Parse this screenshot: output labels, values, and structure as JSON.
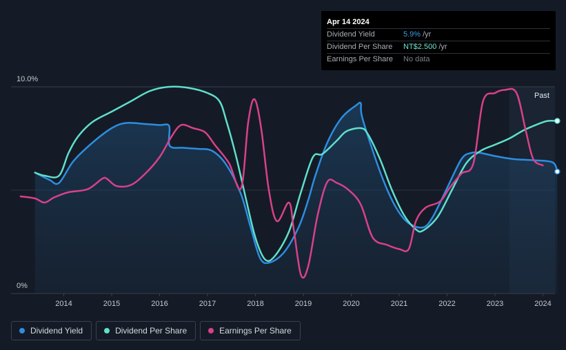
{
  "tooltip": {
    "date": "Apr 14 2024",
    "rows": [
      {
        "label": "Dividend Yield",
        "value": "5.9%",
        "unit": "/yr",
        "color": "#3a9de8"
      },
      {
        "label": "Dividend Per Share",
        "value": "NT$2.500",
        "unit": "/yr",
        "color": "#6ee6d2"
      },
      {
        "label": "Earnings Per Share",
        "value": "No data",
        "unit": "",
        "color": "#7d828c"
      }
    ]
  },
  "past_label": "Past",
  "legend": [
    {
      "label": "Dividend Yield",
      "color": "#2c8ee2"
    },
    {
      "label": "Dividend Per Share",
      "color": "#5fe0cc"
    },
    {
      "label": "Earnings Per Share",
      "color": "#d9418a"
    }
  ],
  "chart_data": {
    "type": "line",
    "x_ticks": [
      "2014",
      "2015",
      "2016",
      "2017",
      "2018",
      "2019",
      "2020",
      "2021",
      "2022",
      "2023",
      "2024"
    ],
    "y_ticks": [
      "0%",
      "10.0%"
    ],
    "y_range": [
      0,
      10
    ],
    "x_range": [
      2013.0,
      2024.3
    ],
    "grid": "horizontal",
    "forecast_shading_from": 2023.3,
    "series": [
      {
        "name": "Dividend Yield",
        "color": "#2c8ee2",
        "unit": "%",
        "points": [
          [
            2013.4,
            5.85
          ],
          [
            2013.7,
            5.5
          ],
          [
            2013.9,
            5.35
          ],
          [
            2014.2,
            6.4
          ],
          [
            2014.6,
            7.3
          ],
          [
            2015.0,
            8.0
          ],
          [
            2015.3,
            8.25
          ],
          [
            2015.7,
            8.2
          ],
          [
            2016.0,
            8.15
          ],
          [
            2016.2,
            8.1
          ],
          [
            2016.21,
            7.15
          ],
          [
            2016.5,
            7.05
          ],
          [
            2016.8,
            7.0
          ],
          [
            2017.1,
            6.9
          ],
          [
            2017.4,
            6.2
          ],
          [
            2017.7,
            4.8
          ],
          [
            2017.9,
            3.2
          ],
          [
            2018.1,
            1.7
          ],
          [
            2018.3,
            1.5
          ],
          [
            2018.6,
            2.0
          ],
          [
            2018.9,
            3.2
          ],
          [
            2019.1,
            4.5
          ],
          [
            2019.25,
            5.7
          ],
          [
            2019.5,
            7.3
          ],
          [
            2019.8,
            8.5
          ],
          [
            2020.1,
            9.1
          ],
          [
            2020.2,
            9.2
          ],
          [
            2020.22,
            8.6
          ],
          [
            2020.45,
            6.9
          ],
          [
            2020.7,
            5.3
          ],
          [
            2020.95,
            4.1
          ],
          [
            2021.2,
            3.4
          ],
          [
            2021.5,
            3.2
          ],
          [
            2021.7,
            3.7
          ],
          [
            2022.0,
            5.1
          ],
          [
            2022.3,
            6.5
          ],
          [
            2022.5,
            6.8
          ],
          [
            2022.7,
            6.8
          ],
          [
            2023.0,
            6.65
          ],
          [
            2023.4,
            6.5
          ],
          [
            2023.8,
            6.45
          ],
          [
            2024.2,
            6.35
          ],
          [
            2024.3,
            5.9
          ]
        ]
      },
      {
        "name": "Dividend Per Share",
        "color": "#5fe0cc",
        "unit": "NT$",
        "points": [
          [
            2013.4,
            5.85
          ],
          [
            2013.6,
            5.7
          ],
          [
            2013.9,
            5.7
          ],
          [
            2014.1,
            6.8
          ],
          [
            2014.3,
            7.6
          ],
          [
            2014.6,
            8.3
          ],
          [
            2015.0,
            8.8
          ],
          [
            2015.4,
            9.3
          ],
          [
            2015.8,
            9.8
          ],
          [
            2016.2,
            10.0
          ],
          [
            2016.6,
            9.95
          ],
          [
            2017.0,
            9.7
          ],
          [
            2017.25,
            9.3
          ],
          [
            2017.4,
            8.3
          ],
          [
            2017.6,
            6.6
          ],
          [
            2017.8,
            4.6
          ],
          [
            2018.0,
            2.7
          ],
          [
            2018.2,
            1.65
          ],
          [
            2018.4,
            1.8
          ],
          [
            2018.7,
            3.0
          ],
          [
            2018.95,
            4.9
          ],
          [
            2019.2,
            6.6
          ],
          [
            2019.4,
            6.75
          ],
          [
            2019.7,
            7.4
          ],
          [
            2019.9,
            7.85
          ],
          [
            2020.2,
            8.0
          ],
          [
            2020.35,
            7.7
          ],
          [
            2020.6,
            6.5
          ],
          [
            2020.85,
            5.0
          ],
          [
            2021.1,
            3.8
          ],
          [
            2021.35,
            3.1
          ],
          [
            2021.5,
            3.05
          ],
          [
            2021.8,
            3.7
          ],
          [
            2022.1,
            5.0
          ],
          [
            2022.4,
            6.3
          ],
          [
            2022.7,
            6.9
          ],
          [
            2023.0,
            7.2
          ],
          [
            2023.3,
            7.5
          ],
          [
            2023.6,
            7.9
          ],
          [
            2023.9,
            8.2
          ],
          [
            2024.1,
            8.35
          ],
          [
            2024.3,
            8.35
          ]
        ]
      },
      {
        "name": "Earnings Per Share",
        "color": "#d9418a",
        "unit": "NT$",
        "points": [
          [
            2013.1,
            4.7
          ],
          [
            2013.4,
            4.6
          ],
          [
            2013.6,
            4.4
          ],
          [
            2013.8,
            4.65
          ],
          [
            2014.1,
            4.9
          ],
          [
            2014.5,
            5.05
          ],
          [
            2014.8,
            5.55
          ],
          [
            2014.9,
            5.55
          ],
          [
            2015.1,
            5.2
          ],
          [
            2015.4,
            5.25
          ],
          [
            2015.7,
            5.8
          ],
          [
            2016.0,
            6.6
          ],
          [
            2016.25,
            7.6
          ],
          [
            2016.45,
            8.15
          ],
          [
            2016.7,
            8.0
          ],
          [
            2016.95,
            7.8
          ],
          [
            2017.15,
            7.2
          ],
          [
            2017.45,
            6.3
          ],
          [
            2017.7,
            5.1
          ],
          [
            2017.85,
            8.3
          ],
          [
            2017.98,
            9.4
          ],
          [
            2018.12,
            8.0
          ],
          [
            2018.28,
            5.0
          ],
          [
            2018.45,
            3.5
          ],
          [
            2018.7,
            4.4
          ],
          [
            2018.8,
            3.1
          ],
          [
            2018.95,
            0.9
          ],
          [
            2019.1,
            1.3
          ],
          [
            2019.3,
            3.8
          ],
          [
            2019.5,
            5.4
          ],
          [
            2019.7,
            5.35
          ],
          [
            2019.95,
            5.0
          ],
          [
            2020.2,
            4.3
          ],
          [
            2020.45,
            2.7
          ],
          [
            2020.75,
            2.35
          ],
          [
            2021.0,
            2.15
          ],
          [
            2021.2,
            2.15
          ],
          [
            2021.35,
            3.5
          ],
          [
            2021.55,
            4.15
          ],
          [
            2021.85,
            4.45
          ],
          [
            2022.05,
            5.1
          ],
          [
            2022.3,
            5.8
          ],
          [
            2022.55,
            6.3
          ],
          [
            2022.75,
            9.3
          ],
          [
            2023.0,
            9.7
          ],
          [
            2023.2,
            9.85
          ],
          [
            2023.45,
            9.7
          ],
          [
            2023.65,
            7.8
          ],
          [
            2023.8,
            6.5
          ],
          [
            2024.0,
            6.2
          ]
        ]
      }
    ]
  }
}
